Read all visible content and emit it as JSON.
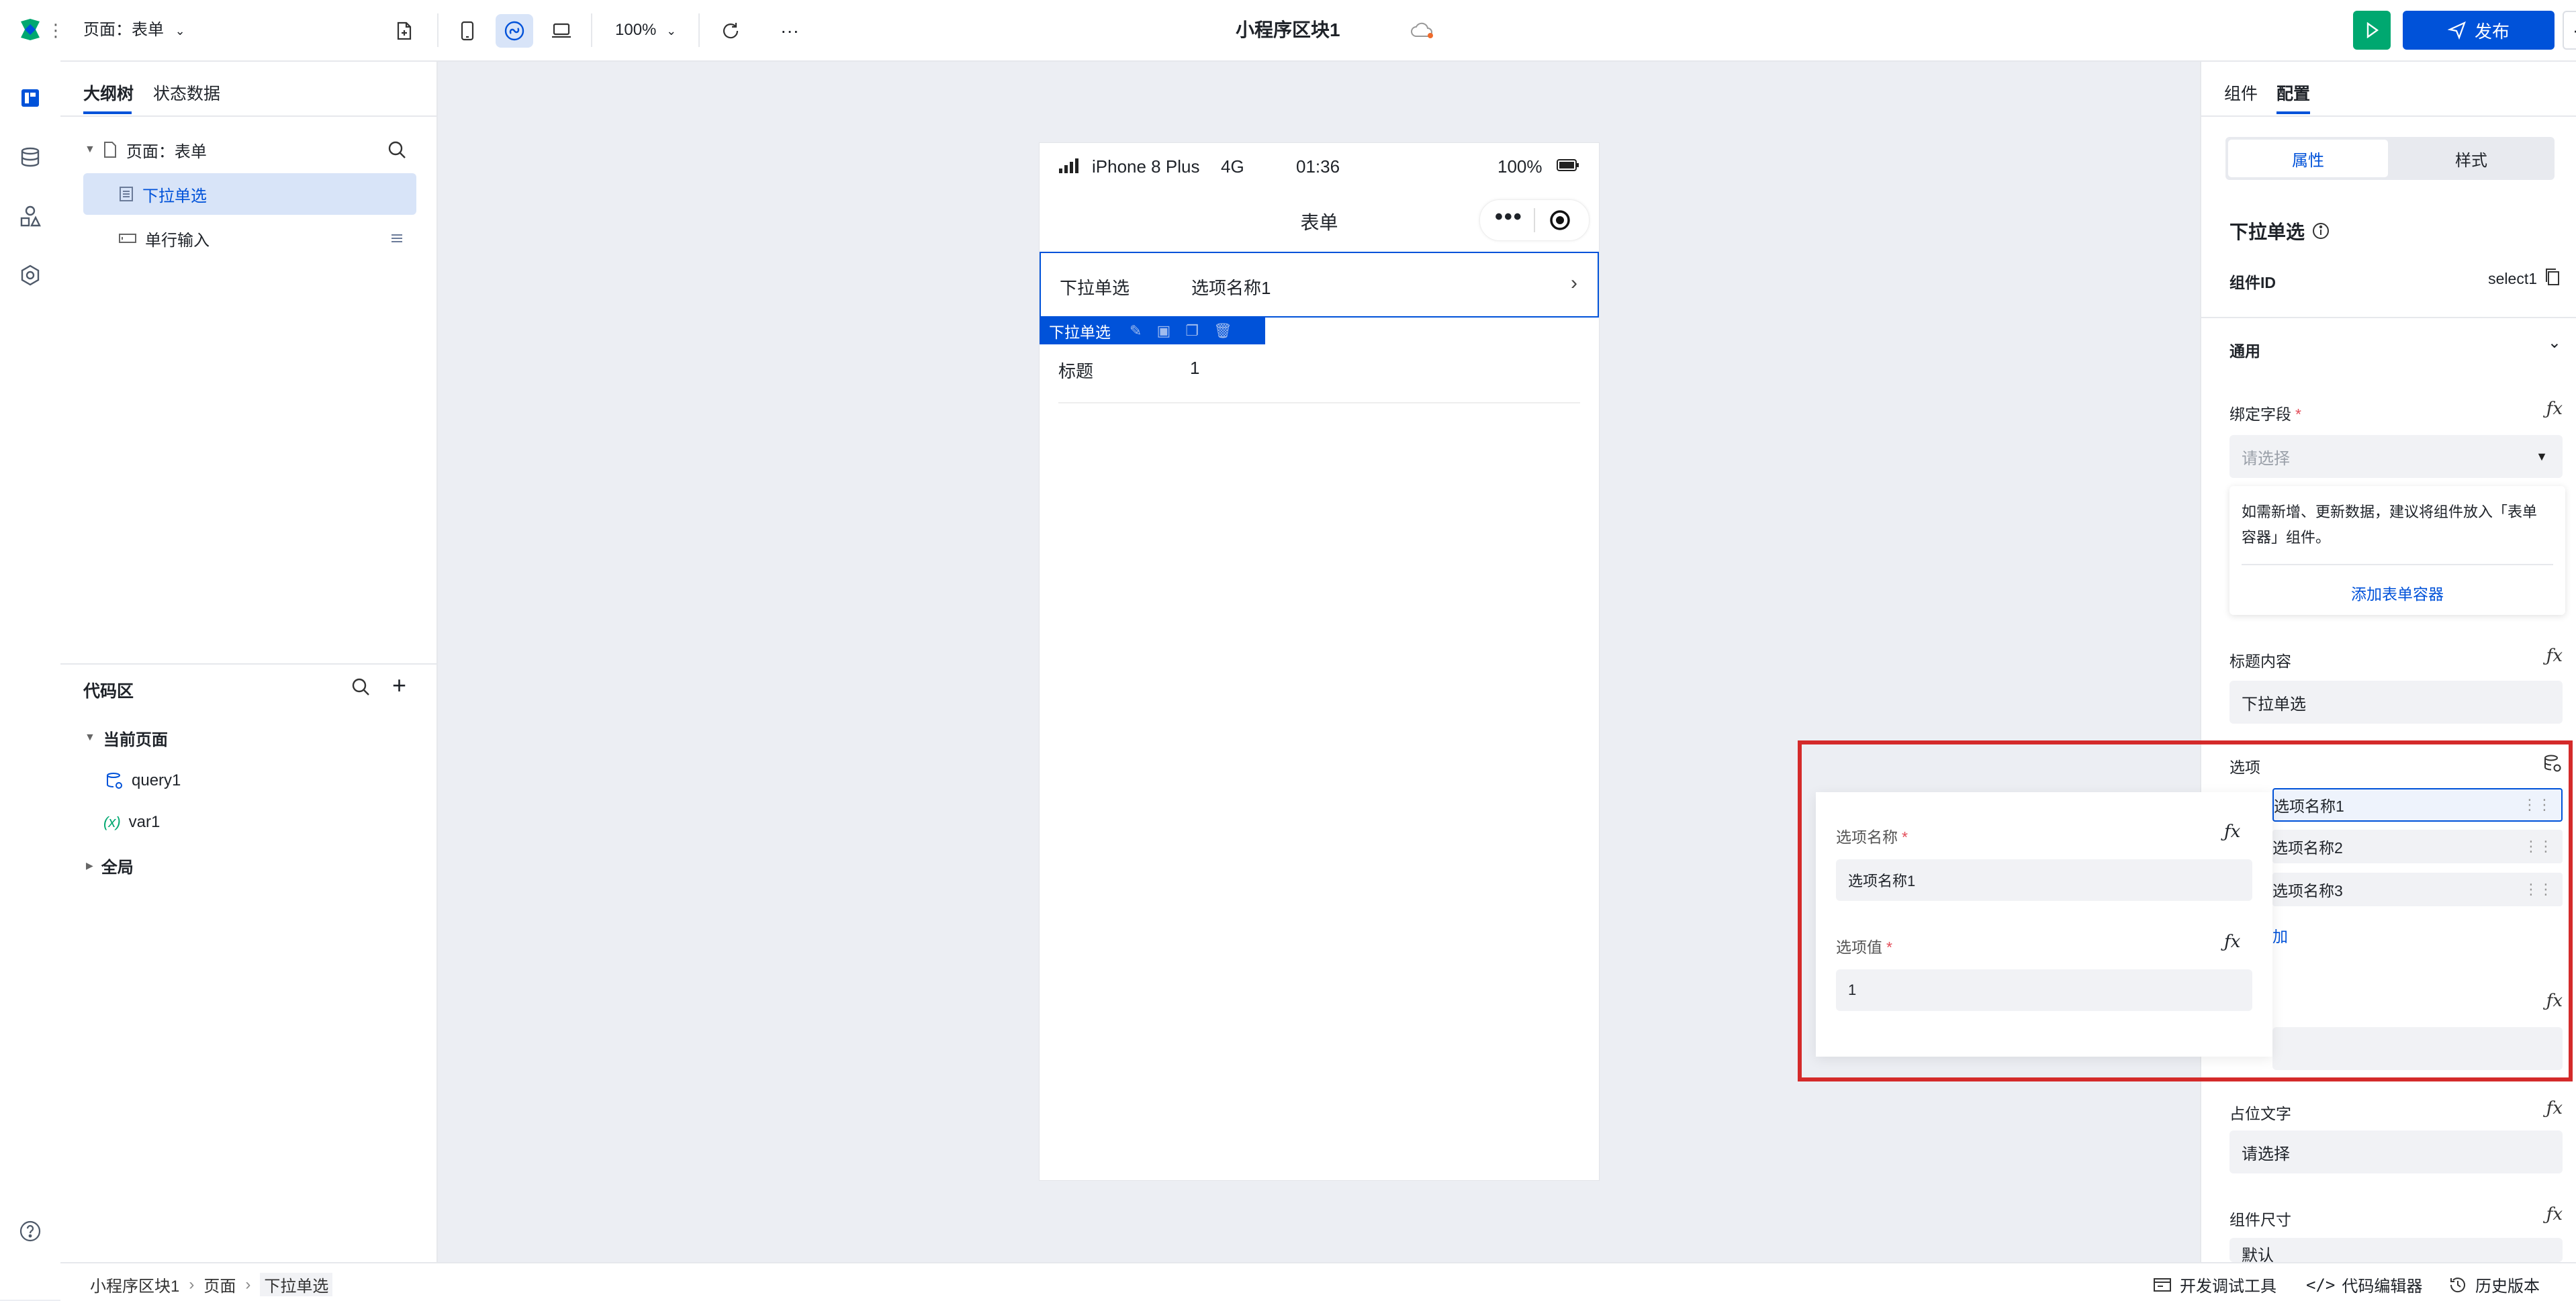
{
  "topbar": {
    "page_selector": "页面：表单",
    "zoom": "100%",
    "title": "小程序区块1",
    "publish_label": "发布"
  },
  "left_panel": {
    "tabs": [
      {
        "label": "大纲树",
        "active": true
      },
      {
        "label": "状态数据",
        "active": false
      }
    ],
    "tree": {
      "page": "页面：表单",
      "items": [
        {
          "label": "下拉单选",
          "selected": true
        },
        {
          "label": "单行输入",
          "selected": false
        }
      ]
    },
    "code_area": {
      "title": "代码区",
      "current_page": "当前页面",
      "items": [
        {
          "icon": "database-icon",
          "label": "query1"
        },
        {
          "icon": "variable-icon",
          "label": "var1"
        }
      ],
      "global": "全局"
    }
  },
  "phone": {
    "status": {
      "device": "iPhone 8 Plus",
      "network": "4G",
      "time": "01:36",
      "battery": "100%"
    },
    "nav_title": "表单",
    "select_row": {
      "label": "下拉单选",
      "value": "选项名称1"
    },
    "component_tag": "下拉单选",
    "title_row": {
      "label": "标题",
      "value": "1"
    }
  },
  "right_panel": {
    "tabs": [
      {
        "label": "组件",
        "active": false
      },
      {
        "label": "配置",
        "active": true
      }
    ],
    "segments": [
      "属性",
      "样式"
    ],
    "component_name": "下拉单选",
    "component_id_label": "组件ID",
    "component_id": "select1",
    "section_general": "通用",
    "bind_field": {
      "label": "绑定字段",
      "placeholder": "请选择"
    },
    "tip": {
      "text": "如需新增、更新数据，建议将组件放入「表单容器」组件。",
      "link": "添加表单容器"
    },
    "title_content": {
      "label": "标题内容",
      "value": "下拉单选"
    },
    "options": {
      "label": "选项",
      "items": [
        "选项名称1",
        "选项名称2",
        "选项名称3"
      ],
      "add_partial": "加"
    },
    "placeholder_text": {
      "label": "占位文字",
      "value": "请选择"
    },
    "size": {
      "label": "组件尺寸",
      "value": "默认"
    }
  },
  "popover": {
    "name_label": "选项名称",
    "name_value": "选项名称1",
    "value_label": "选项值",
    "value_value": "1"
  },
  "statusbar": {
    "breadcrumb": [
      "小程序区块1",
      "页面",
      "下拉单选"
    ],
    "dev_tools": "开发调试工具",
    "code_editor": "代码编辑器",
    "history": "历史版本"
  },
  "colors": {
    "primary": "#0052d9",
    "success": "#00a870",
    "highlight": "#d42a2a",
    "selected_bg": "#d8e4f8"
  }
}
